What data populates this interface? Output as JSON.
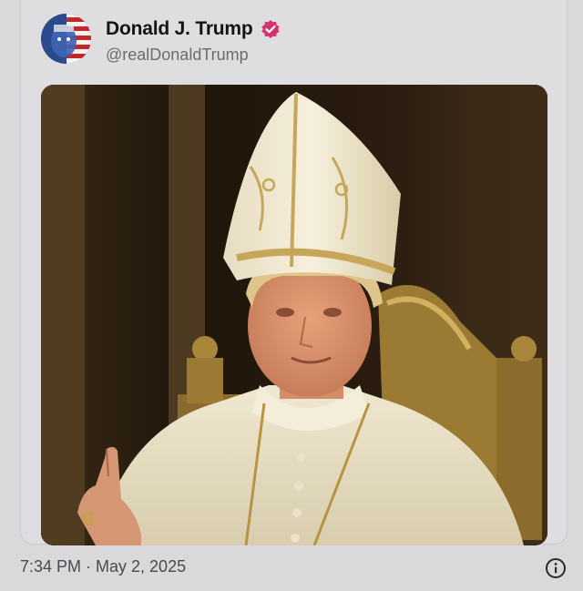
{
  "post": {
    "author_name": "Donald J. Trump",
    "author_handle": "@realDonaldTrump",
    "timestamp": "7:34 PM · May 2, 2025",
    "verified": true,
    "verified_color": "#d6336c"
  },
  "icons": {
    "verified": "verified-badge-icon",
    "info": "info-circle-icon"
  },
  "colors": {
    "card_background": "#dedee0",
    "name_text": "#141414",
    "handle_text": "#6b6b70",
    "timestamp_text": "#4a4a4f"
  }
}
